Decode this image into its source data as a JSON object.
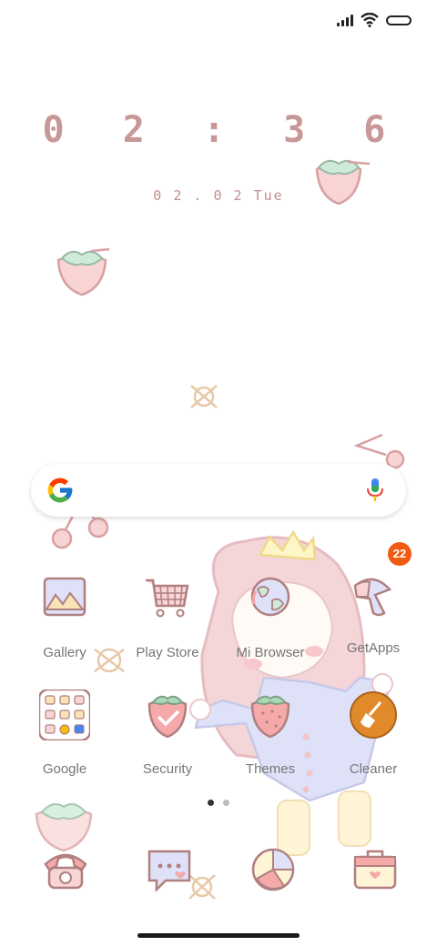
{
  "status_bar": {
    "signal": "signal-icon",
    "wifi": "wifi-icon",
    "battery": "battery-icon"
  },
  "clock": {
    "time": "0 2 : 3 6",
    "date": "0 2 . 0 2  Tue"
  },
  "search": {
    "placeholder": "",
    "google_icon": "google-icon",
    "mic_icon": "mic-icon"
  },
  "apps": [
    {
      "label": "Gallery",
      "icon": "gallery-icon"
    },
    {
      "label": "Play Store",
      "icon": "cart-icon"
    },
    {
      "label": "Mi Browser",
      "icon": "globe-icon"
    },
    {
      "label": "GetApps",
      "icon": "getapps-icon",
      "badge": "22"
    },
    {
      "label": "Google",
      "icon": "google-folder-icon"
    },
    {
      "label": "Security",
      "icon": "security-strawberry-icon"
    },
    {
      "label": "Themes",
      "icon": "themes-strawberry-icon"
    },
    {
      "label": "Cleaner",
      "icon": "broom-icon"
    }
  ],
  "dock": [
    {
      "icon": "phone-icon"
    },
    {
      "icon": "messages-icon"
    },
    {
      "icon": "camera-icon"
    },
    {
      "icon": "tools-icon"
    }
  ],
  "page_indicator": {
    "pages": 2,
    "current": 1
  },
  "colors": {
    "accent": "#c89797",
    "badge": "#f15a12",
    "cleaner": "#e08a2c"
  }
}
